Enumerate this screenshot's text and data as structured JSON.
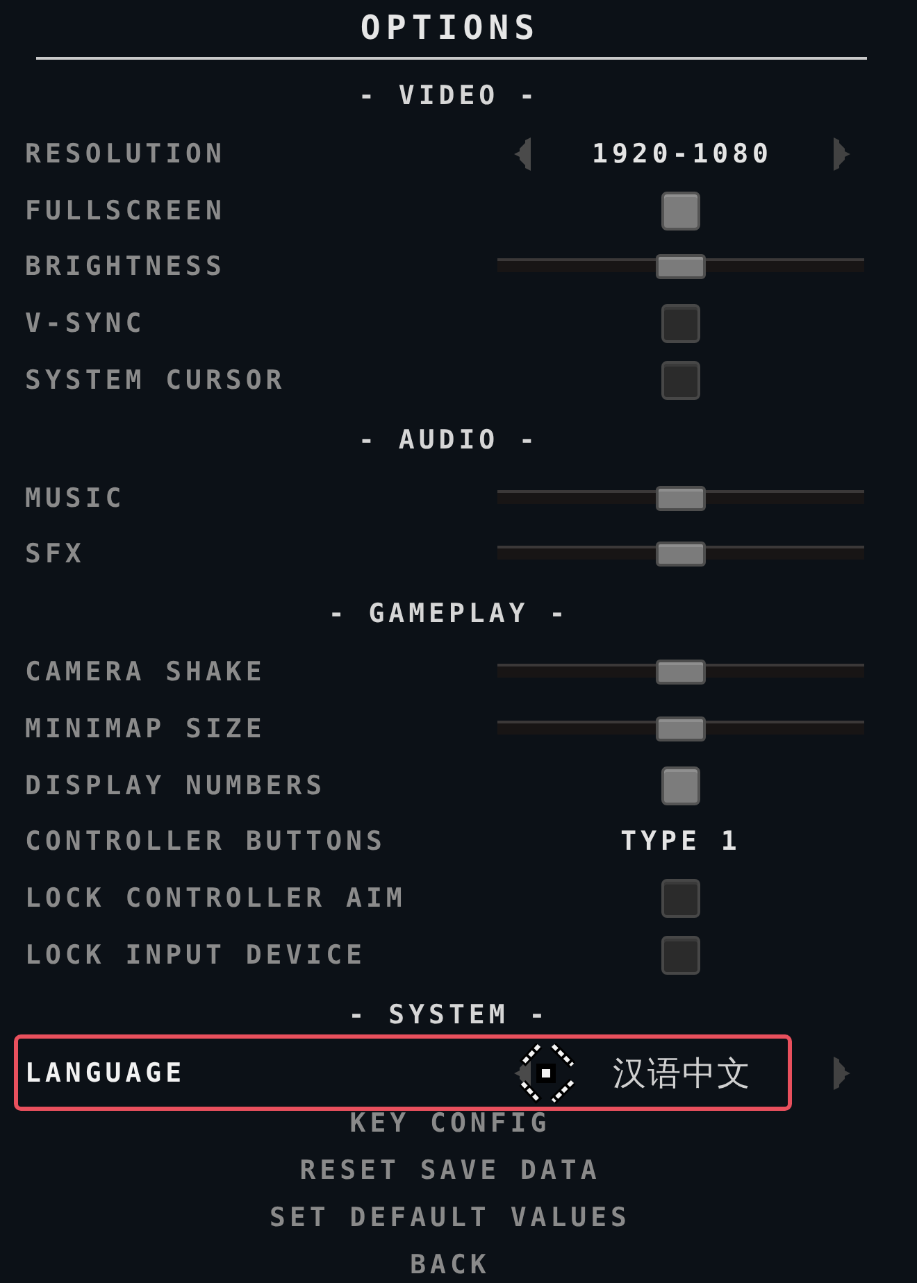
{
  "title": "OPTIONS",
  "sections": [
    {
      "heading": "- VIDEO -",
      "rows": [
        {
          "kind": "selector",
          "label": "RESOLUTION",
          "value": "1920-1080",
          "selected": false
        },
        {
          "kind": "checkbox",
          "label": "FULLSCREEN",
          "checked": true,
          "selected": false
        },
        {
          "kind": "slider",
          "label": "BRIGHTNESS",
          "level": 0.5,
          "selected": false
        },
        {
          "kind": "checkbox",
          "label": "V-SYNC",
          "checked": false,
          "selected": false
        },
        {
          "kind": "checkbox",
          "label": "SYSTEM CURSOR",
          "checked": false,
          "selected": false
        }
      ]
    },
    {
      "heading": "- AUDIO -",
      "rows": [
        {
          "kind": "slider",
          "label": "MUSIC",
          "level": 0.5,
          "selected": false
        },
        {
          "kind": "slider",
          "label": "SFX",
          "level": 0.5,
          "selected": false
        }
      ]
    },
    {
      "heading": "- GAMEPLAY -",
      "rows": [
        {
          "kind": "slider",
          "label": "CAMERA SHAKE",
          "level": 0.5,
          "selected": false
        },
        {
          "kind": "slider",
          "label": "MINIMAP SIZE",
          "level": 0.5,
          "selected": false
        },
        {
          "kind": "checkbox",
          "label": "DISPLAY NUMBERS",
          "checked": true,
          "selected": false
        },
        {
          "kind": "value",
          "label": "CONTROLLER BUTTONS",
          "value": "TYPE 1",
          "selected": false
        },
        {
          "kind": "checkbox",
          "label": "LOCK CONTROLLER AIM",
          "checked": false,
          "selected": false
        },
        {
          "kind": "checkbox",
          "label": "LOCK INPUT DEVICE",
          "checked": false,
          "selected": false
        }
      ]
    },
    {
      "heading": "- SYSTEM -",
      "rows": [
        {
          "kind": "selector",
          "label": "LANGUAGE",
          "value": "汉语中文",
          "selected": true
        }
      ]
    }
  ],
  "buttons": [
    {
      "label": "KEY CONFIG",
      "selected": false
    },
    {
      "label": "RESET SAVE DATA",
      "selected": false
    },
    {
      "label": "SET DEFAULT VALUES",
      "selected": false
    },
    {
      "label": "BACK",
      "selected": false
    }
  ]
}
